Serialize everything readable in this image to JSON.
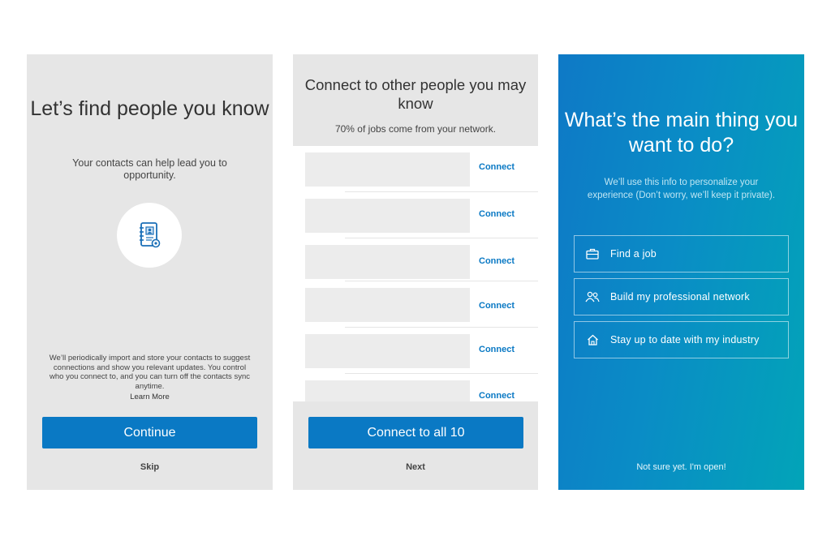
{
  "panel1": {
    "title": "Let’s find people you know",
    "subtitle": "Your contacts can help lead you to opportunity.",
    "icon": "address-book-icon",
    "fineprint": "We’ll periodically import and store your contacts to suggest connections and show you relevant updates. You control who you connect to, and you can turn off the contacts sync anytime.",
    "learn_more": "Learn More",
    "continue_label": "Continue",
    "skip_label": "Skip"
  },
  "panel2": {
    "title": "Connect to other people you may know",
    "subtitle": "70% of jobs come from your network.",
    "rows": [
      {
        "action": "Connect"
      },
      {
        "action": "Connect"
      },
      {
        "action": "Connect"
      },
      {
        "action": "Connect"
      },
      {
        "action": "Connect"
      },
      {
        "action": "Connect"
      }
    ],
    "connect_all_label": "Connect to all 10",
    "next_label": "Next"
  },
  "panel3": {
    "title": "What’s the main thing you want to do?",
    "subtitle": "We’ll use this info to personalize your experience (Don’t worry, we’ll keep it private).",
    "options": [
      {
        "icon": "briefcase-icon",
        "label": "Find a job"
      },
      {
        "icon": "people-icon",
        "label": "Build my professional network"
      },
      {
        "icon": "home-icon",
        "label": "Stay up to date with my industry"
      }
    ],
    "not_sure_label": "Not sure yet. I'm open!"
  },
  "colors": {
    "primary": "#0a79c4",
    "panel_bg": "#e6e6e6",
    "gradient_start": "#0e79c6",
    "gradient_end": "#02a4b8"
  }
}
